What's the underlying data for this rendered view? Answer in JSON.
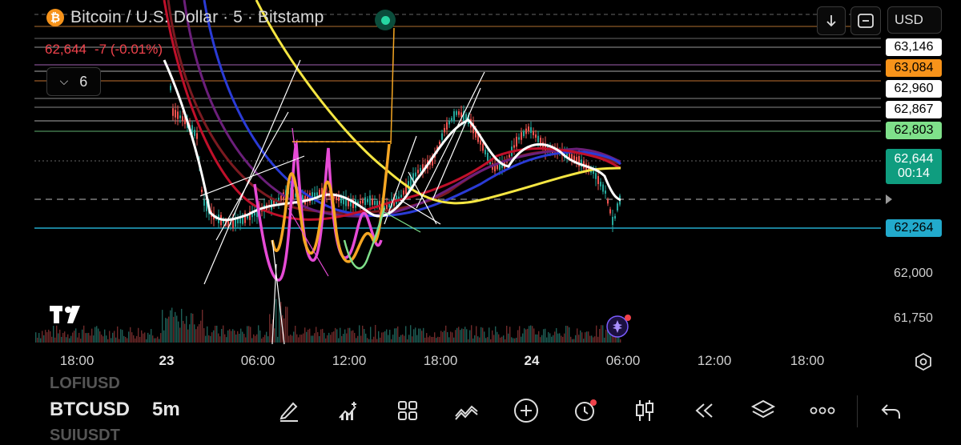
{
  "header": {
    "coin_symbol": "₿",
    "title": "Bitcoin / U.S. Dollar · 5 · Bitstamp",
    "last_price": "62,644",
    "change": "-7 (-0.01%)",
    "indicators_count": "6"
  },
  "toolbar": {
    "currency": "USD"
  },
  "price_tags": [
    {
      "label": "63,146",
      "bg": "#ffffff",
      "fg": "#000000",
      "color_name": "white"
    },
    {
      "label": "63,084",
      "bg": "#f7931a",
      "fg": "#000000",
      "color_name": "orange"
    },
    {
      "label": "62,960",
      "bg": "#ffffff",
      "fg": "#000000",
      "color_name": "white"
    },
    {
      "label": "62,867",
      "bg": "#ffffff",
      "fg": "#000000",
      "color_name": "white"
    },
    {
      "label": "62,803",
      "bg": "#7fe08a",
      "fg": "#000000",
      "color_name": "green"
    },
    {
      "label": "62,644",
      "sub": "00:14",
      "bg": "#0f9d7f",
      "fg": "#ffffff",
      "color_name": "teal"
    },
    {
      "label": "62,264",
      "bg": "#22aacc",
      "fg": "#000000",
      "color_name": "cyan"
    }
  ],
  "price_axis": [
    "62,000",
    "61,750"
  ],
  "time_axis": [
    {
      "label": "18:00",
      "bold": false
    },
    {
      "label": "23",
      "bold": true
    },
    {
      "label": "06:00",
      "bold": false
    },
    {
      "label": "12:00",
      "bold": false
    },
    {
      "label": "18:00",
      "bold": false
    },
    {
      "label": "24",
      "bold": true
    },
    {
      "label": "06:00",
      "bold": false
    },
    {
      "label": "12:00",
      "bold": false
    },
    {
      "label": "18:00",
      "bold": false
    }
  ],
  "bottom": {
    "symbol_prev": "LOFIUSD",
    "symbol": "BTCUSD",
    "interval": "5m",
    "symbol_next": "SUIUSDT"
  },
  "colors": {
    "up": "#26a69a",
    "down": "#ef5350",
    "accent": "#26d6a2",
    "ma_yellow": "#f5e642",
    "ma_white": "#ffffff",
    "ma_blue": "#2a3bd6",
    "ma_red": "#c0102a",
    "ma_purple": "#6b1f7a"
  },
  "icons": [
    "pencil-icon",
    "chart-plus-icon",
    "grid-icon",
    "trend-icon",
    "plus-circle-icon",
    "alarm-icon",
    "candles-icon",
    "rewind-icon",
    "layers-icon",
    "more-icon",
    "undo-icon",
    "tradingview-logo",
    "sparkle-icon",
    "settings-icon",
    "arrow-down-icon",
    "replay-icon"
  ]
}
